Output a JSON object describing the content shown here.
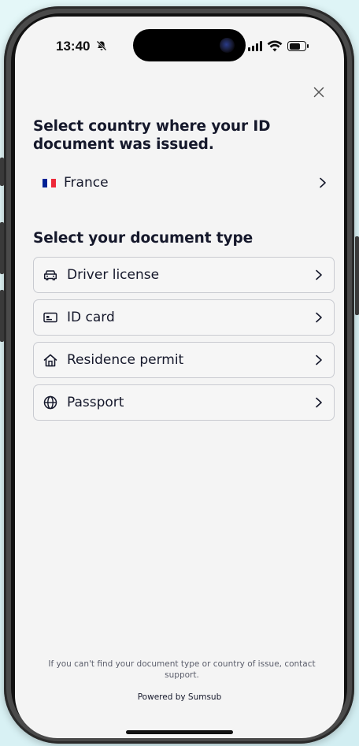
{
  "status_bar": {
    "time": "13:40",
    "silent_icon": "bell-slash-icon",
    "signal_icon": "signal-icon",
    "wifi_icon": "wifi-icon",
    "battery_icon": "battery-icon"
  },
  "dialog": {
    "close_label": "×",
    "country_heading": "Select country where your ID document was issued.",
    "selected_country": {
      "name": "France",
      "flag_colors": [
        "#002395",
        "#ffffff",
        "#ed2939"
      ]
    },
    "document_heading": "Select your document type",
    "document_types": [
      {
        "label": "Driver license",
        "icon": "car-icon"
      },
      {
        "label": "ID card",
        "icon": "id-card-icon"
      },
      {
        "label": "Residence permit",
        "icon": "home-icon"
      },
      {
        "label": "Passport",
        "icon": "globe-icon"
      }
    ],
    "footer_note": "If you can't find your document type or country of issue, contact support.",
    "powered_by": "Powered by Sumsub"
  },
  "colors": {
    "text_primary": "#15182b",
    "border": "#c9cbd1",
    "screen_bg": "#f4f4f4",
    "page_bg": "#d9f1f4"
  }
}
